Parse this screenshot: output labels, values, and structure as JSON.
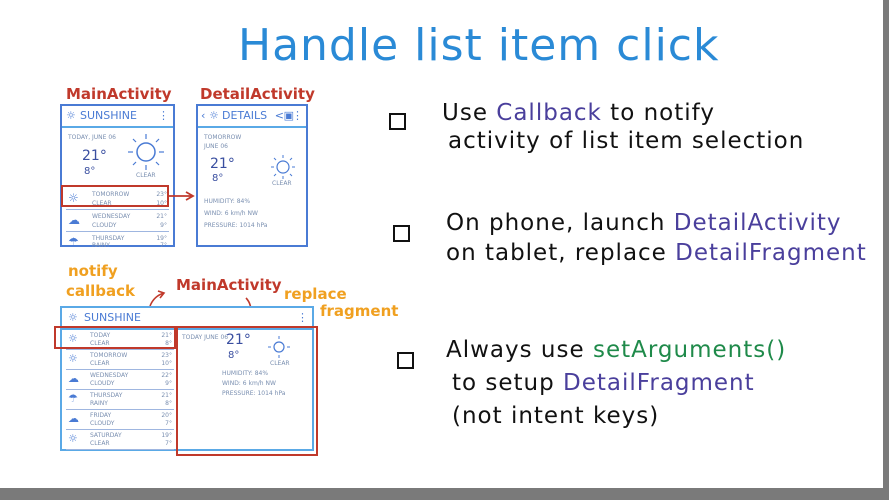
{
  "title": "Handle list item click",
  "labels": {
    "main_activity": "MainActivity",
    "detail_activity": "DetailActivity",
    "notify_callback_1": "notify",
    "notify_callback_2": "callback",
    "main_activity_2": "MainActivity",
    "replace_fragment_1": "replace",
    "replace_fragment_2": "fragment"
  },
  "phone_main": {
    "app_title": "SUNSHINE",
    "today_label": "TODAY, JUNE 06",
    "high": "21°",
    "low": "8°",
    "condition": "CLEAR",
    "rows": [
      {
        "day": "TOMORROW",
        "cond": "CLEAR",
        "high": "23°",
        "low": "10°"
      },
      {
        "day": "WEDNESDAY",
        "cond": "CLOUDY",
        "high": "21°",
        "low": "9°"
      },
      {
        "day": "THURSDAY",
        "cond": "RAINY",
        "high": "19°",
        "low": "7°"
      }
    ]
  },
  "phone_detail": {
    "app_title": "DETAILS",
    "day": "TOMORROW",
    "date": "JUNE 06",
    "high": "21°",
    "low": "8°",
    "condition": "CLEAR",
    "humidity": "HUMIDITY: 84%",
    "wind": "WIND: 6 km/h NW",
    "pressure": "PRESSURE: 1014 hPa"
  },
  "tablet": {
    "app_title": "SUNSHINE",
    "rows": [
      {
        "day": "TODAY",
        "cond": "CLEAR",
        "high": "21°",
        "low": "8°"
      },
      {
        "day": "TOMORROW",
        "cond": "CLEAR",
        "high": "23°",
        "low": "10°"
      },
      {
        "day": "WEDNESDAY",
        "cond": "CLOUDY",
        "high": "22°",
        "low": "9°"
      },
      {
        "day": "THURSDAY",
        "cond": "RAINY",
        "high": "21°",
        "low": "8°"
      },
      {
        "day": "FRIDAY",
        "cond": "CLOUDY",
        "high": "20°",
        "low": "7°"
      },
      {
        "day": "SATURDAY",
        "cond": "CLEAR",
        "high": "19°",
        "low": "7°"
      }
    ],
    "detail": {
      "date": "TODAY JUNE 06",
      "high": "21°",
      "low": "8°",
      "condition": "CLEAR",
      "humidity": "HUMIDITY: 84%",
      "wind": "WIND: 6 km/h NW",
      "pressure": "PRESSURE: 1014 hPa"
    }
  },
  "bullets": [
    {
      "pre": "Use ",
      "kw": "Callback",
      "post": " to notify",
      "line2": "activity of list item selection"
    },
    {
      "pre": "On phone, launch ",
      "kw": "DetailActivity",
      "line2pre": "on tablet, replace ",
      "kw2": "DetailFragment"
    },
    {
      "pre": "Always use ",
      "kw": "setArguments()",
      "line2pre": "to setup ",
      "kw2": "DetailFragment",
      "line3": "(not intent keys)"
    }
  ],
  "colors": {
    "accent_blue": "#2a8ad6",
    "frame_blue": "#4a7bd4",
    "red": "#c0392b",
    "orange": "#f0a020",
    "purple": "#4a3f9c",
    "green": "#1f8a4a"
  }
}
